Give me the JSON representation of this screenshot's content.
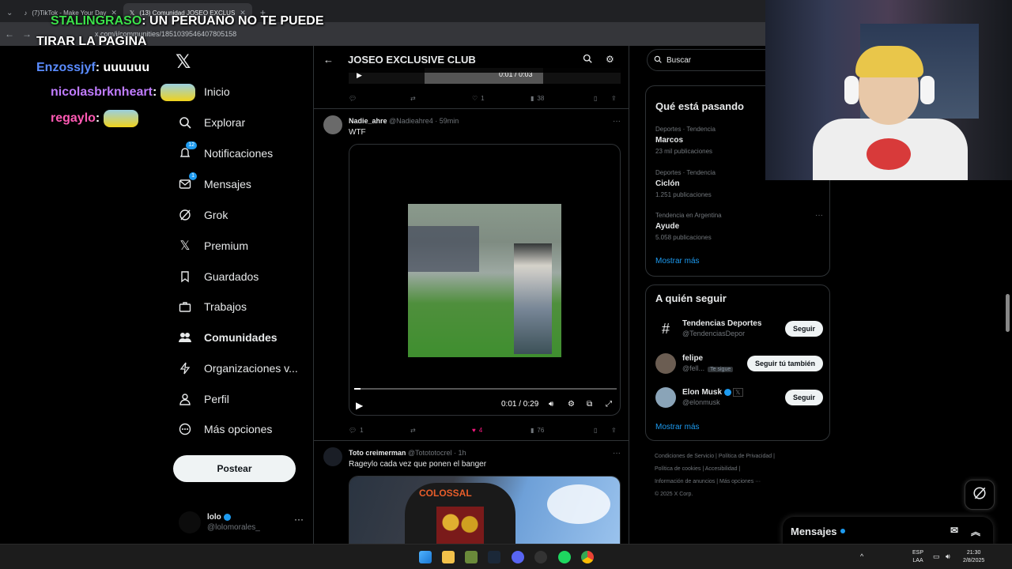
{
  "browser": {
    "tabs": [
      {
        "label": "(7)TikTok - Make Your Day"
      },
      {
        "label": "(13) Comunidad JOSEO EXCLUS"
      }
    ],
    "url": "x.com/i/communities/1851039546407805158"
  },
  "chat": {
    "lines": [
      {
        "user": "STALINGRASO",
        "msg": ": UN PERUANO NO TE PUEDE",
        "color": "#3ce14b"
      },
      {
        "user": "",
        "msg": "TIRAR LA PAGINA",
        "color": "#ffffff"
      },
      {
        "user": "Enzossjyf",
        "msg": ": uuuuuu",
        "color": "#5a8cff"
      },
      {
        "user": "nicolasbrknheart",
        "msg": ":",
        "color": "#c07cff"
      },
      {
        "user": "regaylo",
        "msg": ":",
        "color": "#ff5ab4"
      }
    ]
  },
  "sidebar": {
    "items": [
      {
        "label": "Inicio",
        "icon": "home-icon"
      },
      {
        "label": "Explorar",
        "icon": "search-icon"
      },
      {
        "label": "Notificaciones",
        "icon": "bell-icon",
        "badge": "12"
      },
      {
        "label": "Mensajes",
        "icon": "mail-icon",
        "badge": "1"
      },
      {
        "label": "Grok",
        "icon": "grok-icon"
      },
      {
        "label": "Premium",
        "icon": "x-icon"
      },
      {
        "label": "Guardados",
        "icon": "bookmark-icon"
      },
      {
        "label": "Trabajos",
        "icon": "briefcase-icon"
      },
      {
        "label": "Comunidades",
        "icon": "people-icon"
      },
      {
        "label": "Organizaciones v...",
        "icon": "lightning-icon"
      },
      {
        "label": "Perfil",
        "icon": "person-icon"
      },
      {
        "label": "Más opciones",
        "icon": "more-circle-icon"
      }
    ],
    "post_label": "Postear",
    "user": {
      "name": "lolo",
      "handle": "@lolomorales_"
    }
  },
  "timeline": {
    "title": "JOSEO EXCLUSIVE CLUB",
    "prev_actions": {
      "replies": "",
      "retweets": "",
      "likes": "1",
      "views": "38"
    },
    "prev_time": "0:01 / 0:03",
    "tweets": [
      {
        "name": "Nadie_ahre",
        "handle": "@Nadieahre4",
        "time": "59min",
        "text": "WTF",
        "video_time": "0:01 / 0:29",
        "replies": "1",
        "retweets": "",
        "likes": "4",
        "views": "76"
      },
      {
        "name": "Toto creimerman",
        "handle": "@Totototocrel",
        "time": "1h",
        "text": "Rageylo cada vez que ponen el banger",
        "image_text": "COLOSSAL"
      }
    ]
  },
  "right": {
    "search_placeholder": "Buscar",
    "trends_title": "Qué está pasando",
    "trends": [
      {
        "context": "Deportes · Tendencia",
        "name": "Marcos",
        "posts": "23 mil publicaciones"
      },
      {
        "context": "Deportes · Tendencia",
        "name": "Ciclón",
        "posts": "1.251 publicaciones"
      },
      {
        "context": "Tendencia en Argentina",
        "name": "Ayude",
        "posts": "5.058 publicaciones"
      }
    ],
    "show_more": "Mostrar más",
    "who_title": "A quién seguir",
    "who": [
      {
        "name": "Tendencias Deportes",
        "handle": "@TendenciasDepor",
        "button": "Seguir"
      },
      {
        "name": "felipe",
        "handle": "@fell...",
        "button": "Seguir tú también",
        "tag": "Te sigue"
      },
      {
        "name": "Elon Musk",
        "handle": "@elonmusk",
        "button": "Seguir"
      }
    ],
    "who_more": "Mostrar más",
    "footer": [
      "Condiciones de Servicio",
      "Política de Privacidad",
      "Política de cookies",
      "Accesibilidad",
      "Información de anuncios",
      "Más opciones ···",
      "© 2025 X Corp."
    ]
  },
  "messages_drawer": {
    "label": "Mensajes"
  },
  "taskbar": {
    "lang": "ESP",
    "lang2": "LAA",
    "time": "21:30",
    "date": "2/8/2025"
  },
  "colors": {
    "accent": "#1d9bf0",
    "like": "#f91880",
    "bg": "#000000"
  }
}
